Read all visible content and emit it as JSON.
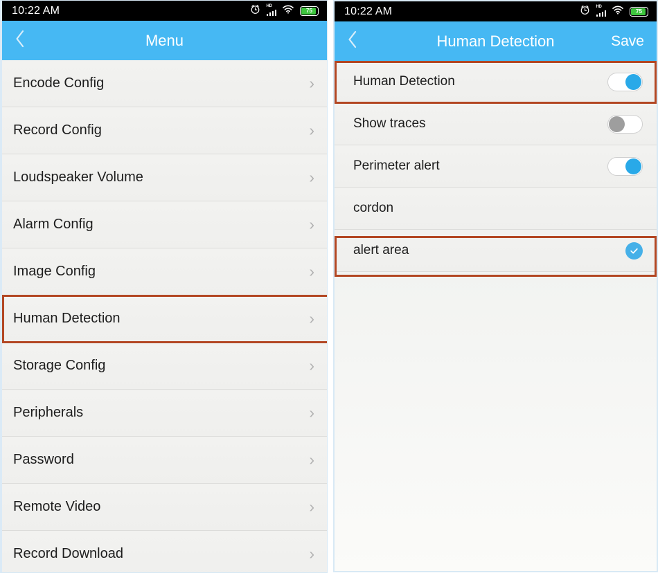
{
  "colors": {
    "appbar_blue": "#46b8f3",
    "status_black": "#000000",
    "highlight_red": "#b34723",
    "toggle_on_blue": "#29a9e8",
    "toggle_off_gray": "#9e9e9e",
    "check_blue": "#46b0e8",
    "battery_green": "#3ec63e",
    "row_bg": "#f1f1ef",
    "panel_border": "#d8e9f5"
  },
  "status_bar": {
    "time": "10:22 AM",
    "battery_percent": "75",
    "icons": [
      "alarm-clock-icon",
      "hd-signal-icon",
      "wifi-icon",
      "battery-icon"
    ]
  },
  "left_screen": {
    "appbar": {
      "back_icon": "chevron-left-icon",
      "title": "Menu"
    },
    "menu_items": [
      {
        "label": "Encode Config",
        "accessory": "chevron-right-icon",
        "highlighted": false
      },
      {
        "label": "Record Config",
        "accessory": "chevron-right-icon",
        "highlighted": false
      },
      {
        "label": "Loudspeaker Volume",
        "accessory": "chevron-right-icon",
        "highlighted": false
      },
      {
        "label": "Alarm Config",
        "accessory": "chevron-right-icon",
        "highlighted": false
      },
      {
        "label": "Image Config",
        "accessory": "chevron-right-icon",
        "highlighted": false
      },
      {
        "label": "Human Detection",
        "accessory": "chevron-right-icon",
        "highlighted": true
      },
      {
        "label": "Storage Config",
        "accessory": "chevron-right-icon",
        "highlighted": false
      },
      {
        "label": "Peripherals",
        "accessory": "chevron-right-icon",
        "highlighted": false
      },
      {
        "label": "Password",
        "accessory": "chevron-right-icon",
        "highlighted": false
      },
      {
        "label": "Remote Video",
        "accessory": "chevron-right-icon",
        "highlighted": false
      },
      {
        "label": "Record Download",
        "accessory": "chevron-right-icon",
        "highlighted": false
      }
    ]
  },
  "right_screen": {
    "appbar": {
      "back_icon": "chevron-left-icon",
      "title": "Human Detection",
      "save_label": "Save"
    },
    "settings": [
      {
        "label": "Human Detection",
        "control": "toggle",
        "state": "on",
        "highlighted": true
      },
      {
        "label": "Show traces",
        "control": "toggle",
        "state": "off",
        "highlighted": false
      },
      {
        "label": "Perimeter alert",
        "control": "toggle",
        "state": "on",
        "highlighted": false
      },
      {
        "label": "cordon",
        "control": "none",
        "state": "",
        "highlighted": false
      },
      {
        "label": "alert area",
        "control": "check",
        "state": "selected",
        "highlighted": true
      }
    ]
  }
}
